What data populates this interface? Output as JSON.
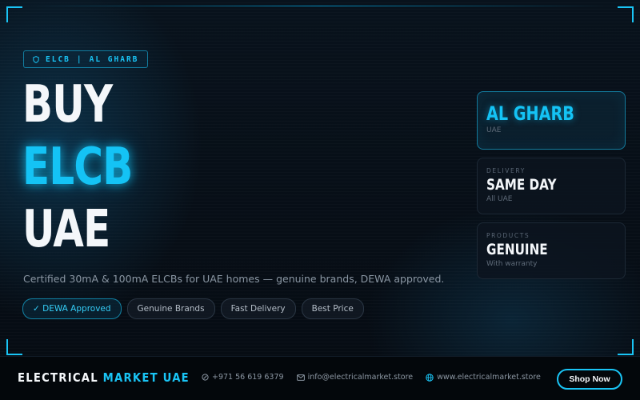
{
  "badge": {
    "icon": "shield-icon",
    "left": "ELCB",
    "separator": "|",
    "right": "AL GHARB"
  },
  "headline": {
    "line1": "BUY",
    "line2": "ELCB",
    "line3": "UAE"
  },
  "description": "Certified 30mA & 100mA ELCBs for UAE homes — genuine brands, DEWA approved.",
  "features": [
    {
      "label": "✓ DEWA Approved",
      "active": true
    },
    {
      "label": "Genuine Brands",
      "active": false
    },
    {
      "label": "Fast Delivery",
      "active": false
    },
    {
      "label": "Best Price",
      "active": false
    }
  ],
  "cards": [
    {
      "label": "",
      "title": "AL GHARB",
      "sub": "UAE"
    },
    {
      "label": "DELIVERY",
      "title": "SAME DAY",
      "sub": "All UAE"
    },
    {
      "label": "PRODUCTS",
      "title": "GENUINE",
      "sub": "With warranty"
    }
  ],
  "footer": {
    "brand_white": "ELECTRICAL",
    "brand_blue": "MARKET UAE",
    "phone": "+971 56 619 6379",
    "email": "info@electricalmarket.store",
    "website": "www.electricalmarket.store",
    "cta": "Shop Now"
  },
  "colors": {
    "accent": "#19c4f5",
    "background": "#060b12",
    "text": "#f4f7fa",
    "muted": "#8a96a3"
  }
}
